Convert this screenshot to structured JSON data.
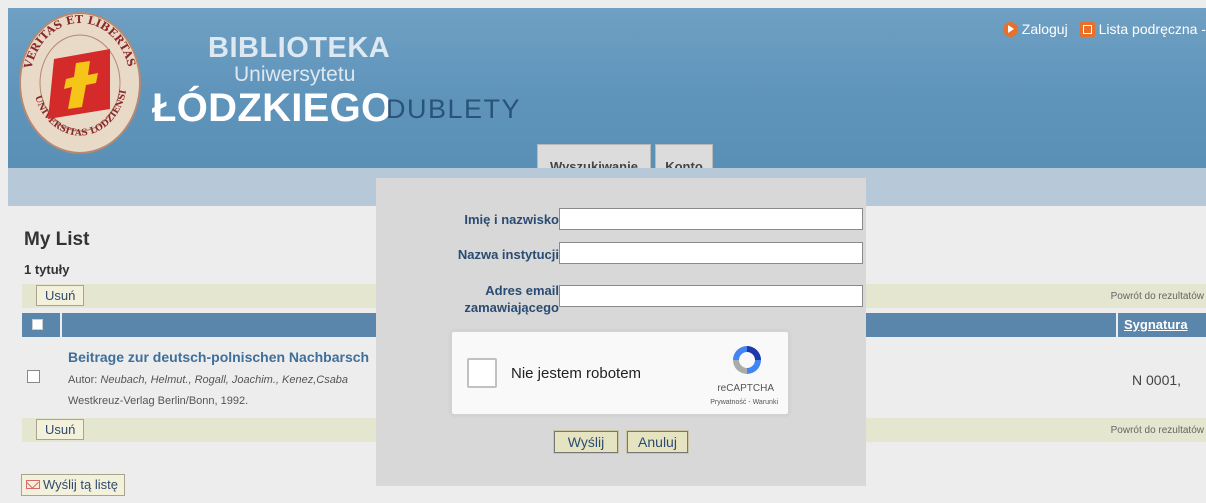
{
  "header": {
    "seal_text_top": "VERITAS ET LIBERTAS",
    "seal_text_bottom": "UNIVERSITAS LODZIENSIS",
    "brand_line1": "BIBLIOTEKA",
    "brand_line2": "Uniwersytetu",
    "brand_line3": "ŁÓDZKIEGO",
    "brand_suffix": "DUBLETY",
    "links": {
      "login": "Zaloguj",
      "list": "Lista podręczna -"
    },
    "tabs": [
      {
        "label": "Wyszukiwanie"
      },
      {
        "label": "Konto"
      }
    ]
  },
  "page": {
    "title": "My List",
    "count": "1 tytuły",
    "remove_label": "Usuń",
    "back_label": "Powrót do rezultatów",
    "columns": {
      "signature": "Sygnatura"
    },
    "items": [
      {
        "title": "Beitrage zur deutsch-polnischen Nachbarsch",
        "author_label": "Autor:",
        "authors": "Neubach, Helmut., Rogall, Joachim., Kenez,Csaba",
        "publisher": "Westkreuz-Verlag Berlin/Bonn, 1992.",
        "signature": "N 0001,"
      }
    ],
    "send_list_label": "Wyślij tą listę"
  },
  "modal": {
    "name_label": "Imię i nazwisko",
    "name_value": "",
    "institution_label": "Nazwa instytucji",
    "institution_value": "",
    "email_label_line1": "Adres email",
    "email_label_line2": "zamawiającego",
    "email_value": "",
    "captcha": {
      "label": "Nie jestem robotem",
      "brand": "reCAPTCHA",
      "terms": "Prywatność - Warunki"
    },
    "submit_label": "Wyślij",
    "cancel_label": "Anuluj"
  },
  "colors": {
    "header_blue": "#5e93ba",
    "nav_bar": "#b7c9d8",
    "table_header": "#5b86ac",
    "link": "#3f6f9a",
    "accent_orange": "#e8702a",
    "logo_red": "#d42a2a",
    "logo_yellow": "#f5c518"
  }
}
